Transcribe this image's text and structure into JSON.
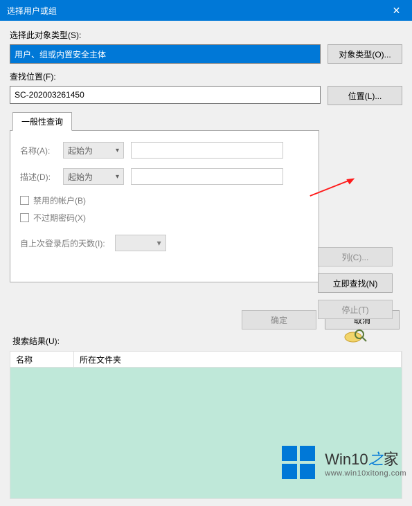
{
  "title": "选择用户或组",
  "close_glyph": "✕",
  "object_type": {
    "label": "选择此对象类型(S):",
    "value": "用户、组或内置安全主体",
    "button": "对象类型(O)..."
  },
  "location": {
    "label": "查找位置(F):",
    "value": "SC-202003261450",
    "button": "位置(L)..."
  },
  "tab_label": "一般性查询",
  "query": {
    "name_label": "名称(A):",
    "desc_label": "描述(D):",
    "match_label": "起始为",
    "chk_disabled": "禁用的帐户(B)",
    "chk_noexpire": "不过期密码(X)",
    "days_label": "自上次登录后的天数(I):"
  },
  "side_buttons": {
    "columns": "列(C)...",
    "find_now": "立即查找(N)",
    "stop": "停止(T)"
  },
  "bottom": {
    "ok": "确定",
    "cancel": "取消"
  },
  "results": {
    "label": "搜索结果(U):",
    "col_name": "名称",
    "col_folder": "所在文件夹"
  },
  "watermark": {
    "title_a": "Win10",
    "title_b": "之",
    "title_c": "家",
    "url": "www.win10xitong.com"
  }
}
